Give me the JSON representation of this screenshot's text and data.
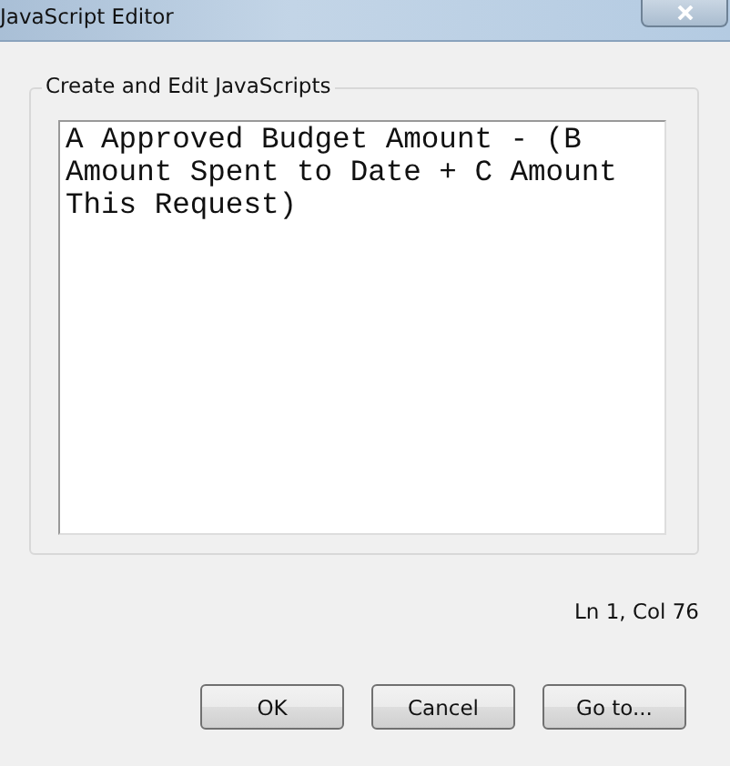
{
  "window": {
    "title": "JavaScript Editor"
  },
  "group": {
    "label": "Create and Edit JavaScripts"
  },
  "editor": {
    "value": "A Approved Budget Amount - (B Amount Spent to Date + C Amount This Request)"
  },
  "status": "Ln 1, Col 76",
  "buttons": [
    "OK",
    "Cancel",
    "Go to..."
  ]
}
